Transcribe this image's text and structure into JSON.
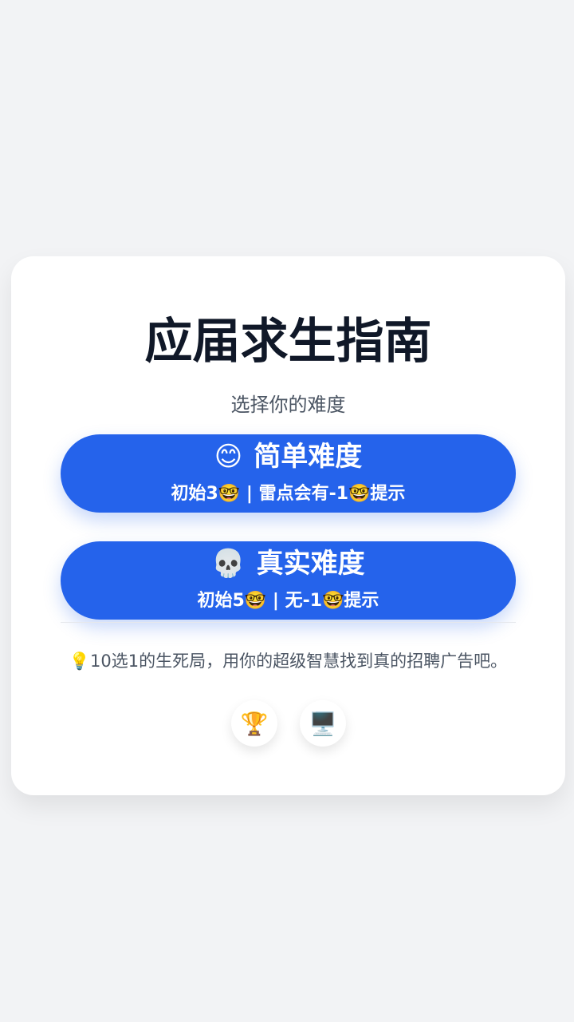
{
  "title": "应届求生指南",
  "subtitle": "选择你的难度",
  "modes": [
    {
      "emoji": "😊",
      "icon_name": "smile-icon",
      "label": "简单难度",
      "description": "初始3🤓 | 雷点会有-1🤓提示"
    },
    {
      "emoji": "💀",
      "icon_name": "skull-icon",
      "label": "真实难度",
      "description": "初始5🤓 | 无-1🤓提示"
    }
  ],
  "tip": "💡10选1的生死局，用你的超级智慧找到真的招聘广告吧。",
  "icon_buttons": [
    {
      "emoji": "🏆",
      "icon_name": "trophy-icon"
    },
    {
      "emoji": "🖥️",
      "icon_name": "computer-icon"
    }
  ],
  "colors": {
    "background": "#f2f3f5",
    "card": "#ffffff",
    "accent": "#2563eb",
    "title": "#101828",
    "text_secondary": "#4b5563"
  }
}
